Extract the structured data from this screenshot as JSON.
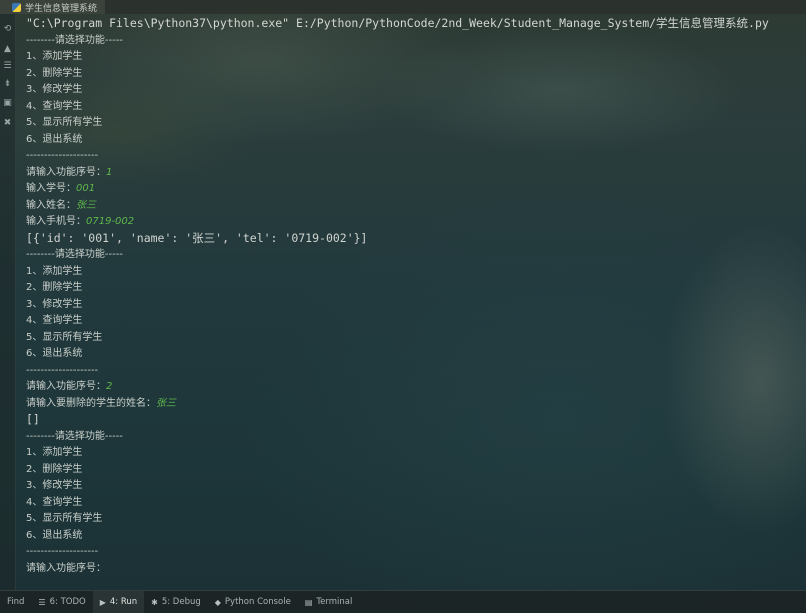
{
  "window": {
    "tab_title": "学生信息管理系统"
  },
  "console_lines": [
    {
      "text": "\"C:\\Program Files\\Python37\\python.exe\" E:/Python/PythonCode/2nd_Week/Student_Manage_System/学生信息管理系统.py",
      "kind": "cmd"
    },
    {
      "text": "--------请选择功能-----",
      "kind": "plain"
    },
    {
      "text": "1、添加学生",
      "kind": "plain"
    },
    {
      "text": "2、删除学生",
      "kind": "plain"
    },
    {
      "text": "3、修改学生",
      "kind": "plain"
    },
    {
      "text": "4、查询学生",
      "kind": "plain"
    },
    {
      "text": "5、显示所有学生",
      "kind": "plain"
    },
    {
      "text": "6、退出系统",
      "kind": "plain"
    },
    {
      "text": "--------------------",
      "kind": "plain"
    },
    {
      "text": "请输入功能序号：",
      "kind": "prompt",
      "input": "1"
    },
    {
      "text": "输入学号：",
      "kind": "prompt",
      "input": "001"
    },
    {
      "text": "输入姓名：",
      "kind": "prompt",
      "input": "张三"
    },
    {
      "text": "输入手机号：",
      "kind": "prompt",
      "input": "0719-002"
    },
    {
      "text": "[{'id': '001', 'name': '张三', 'tel': '0719-002'}]",
      "kind": "result"
    },
    {
      "text": "--------请选择功能-----",
      "kind": "plain"
    },
    {
      "text": "1、添加学生",
      "kind": "plain"
    },
    {
      "text": "2、删除学生",
      "kind": "plain"
    },
    {
      "text": "3、修改学生",
      "kind": "plain"
    },
    {
      "text": "4、查询学生",
      "kind": "plain"
    },
    {
      "text": "5、显示所有学生",
      "kind": "plain"
    },
    {
      "text": "6、退出系统",
      "kind": "plain"
    },
    {
      "text": "--------------------",
      "kind": "plain"
    },
    {
      "text": "请输入功能序号：",
      "kind": "prompt",
      "input": "2"
    },
    {
      "text": "请输入要删除的学生的姓名：",
      "kind": "prompt",
      "input": "张三"
    },
    {
      "text": "[]",
      "kind": "result"
    },
    {
      "text": "--------请选择功能-----",
      "kind": "plain"
    },
    {
      "text": "1、添加学生",
      "kind": "plain"
    },
    {
      "text": "2、删除学生",
      "kind": "plain"
    },
    {
      "text": "3、修改学生",
      "kind": "plain"
    },
    {
      "text": "4、查询学生",
      "kind": "plain"
    },
    {
      "text": "5、显示所有学生",
      "kind": "plain"
    },
    {
      "text": "6、退出系统",
      "kind": "plain"
    },
    {
      "text": "--------------------",
      "kind": "plain"
    },
    {
      "text": "请输入功能序号：",
      "kind": "prompt",
      "input": ""
    }
  ],
  "bottom_tabs": [
    {
      "label": "Find",
      "icon": ""
    },
    {
      "label": "6: TODO",
      "icon": "list-icon"
    },
    {
      "label": "4: Run",
      "icon": "run-icon",
      "active": true
    },
    {
      "label": "5: Debug",
      "icon": "bug-icon"
    },
    {
      "label": "Python Console",
      "icon": "python-icon"
    },
    {
      "label": "Terminal",
      "icon": "terminal-icon"
    }
  ],
  "colors": {
    "input": "#5fb84a",
    "text": "#c5ccc9",
    "accent": "#3b77b4"
  }
}
